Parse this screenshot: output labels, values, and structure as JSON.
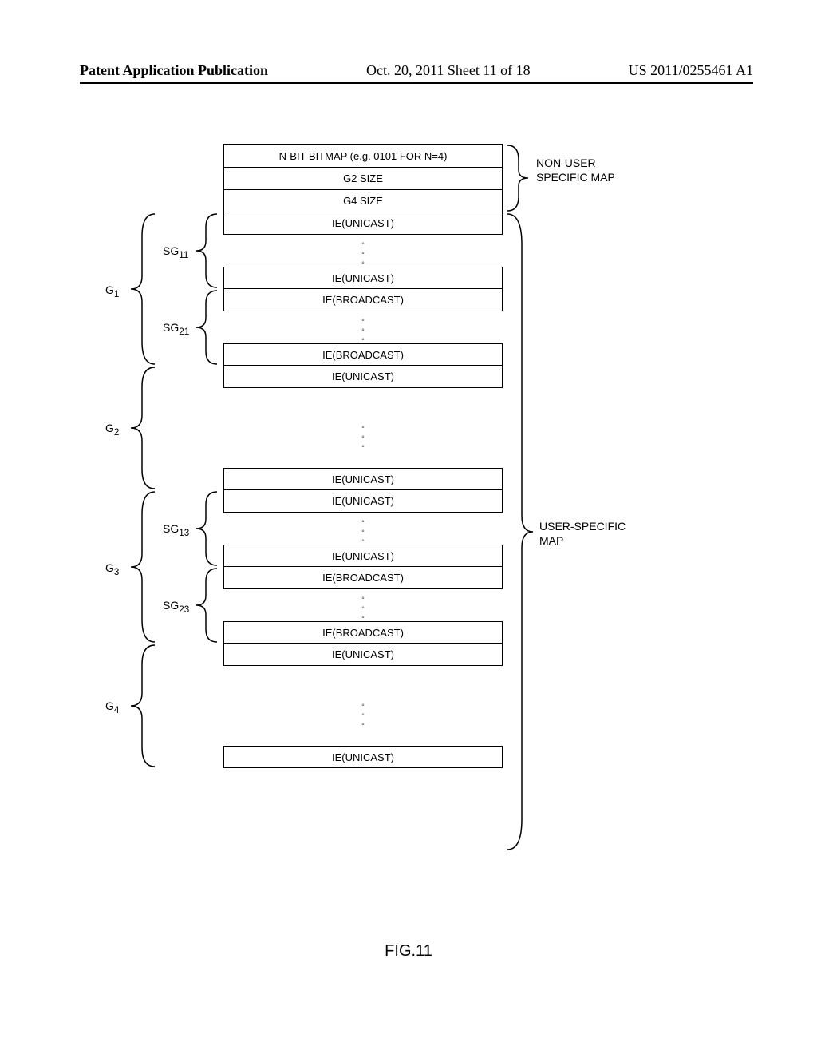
{
  "header": {
    "left": "Patent Application Publication",
    "mid": "Oct. 20, 2011   Sheet 11 of 18",
    "right": "US 2011/0255461 A1"
  },
  "figure": {
    "caption": "FIG.11",
    "cells": {
      "bitmap": "N-BIT BITMAP (e.g. 0101 FOR N=4)",
      "g2size": "G2 SIZE",
      "g4size": "G4 SIZE",
      "ie_unicast": "IE(UNICAST)",
      "ie_broadcast": "IE(BROADCAST)"
    },
    "labels": {
      "non_user_specific": "NON-USER SPECIFIC MAP",
      "user_specific": "USER-SPECIFIC MAP",
      "G1": "G",
      "G1_sub": "1",
      "G2": "G",
      "G2_sub": "2",
      "G3": "G",
      "G3_sub": "3",
      "G4": "G",
      "G4_sub": "4",
      "SG11": "SG",
      "SG11_sub": "11",
      "SG21": "SG",
      "SG21_sub": "21",
      "SG13": "SG",
      "SG13_sub": "13",
      "SG23": "SG",
      "SG23_sub": "23"
    }
  }
}
